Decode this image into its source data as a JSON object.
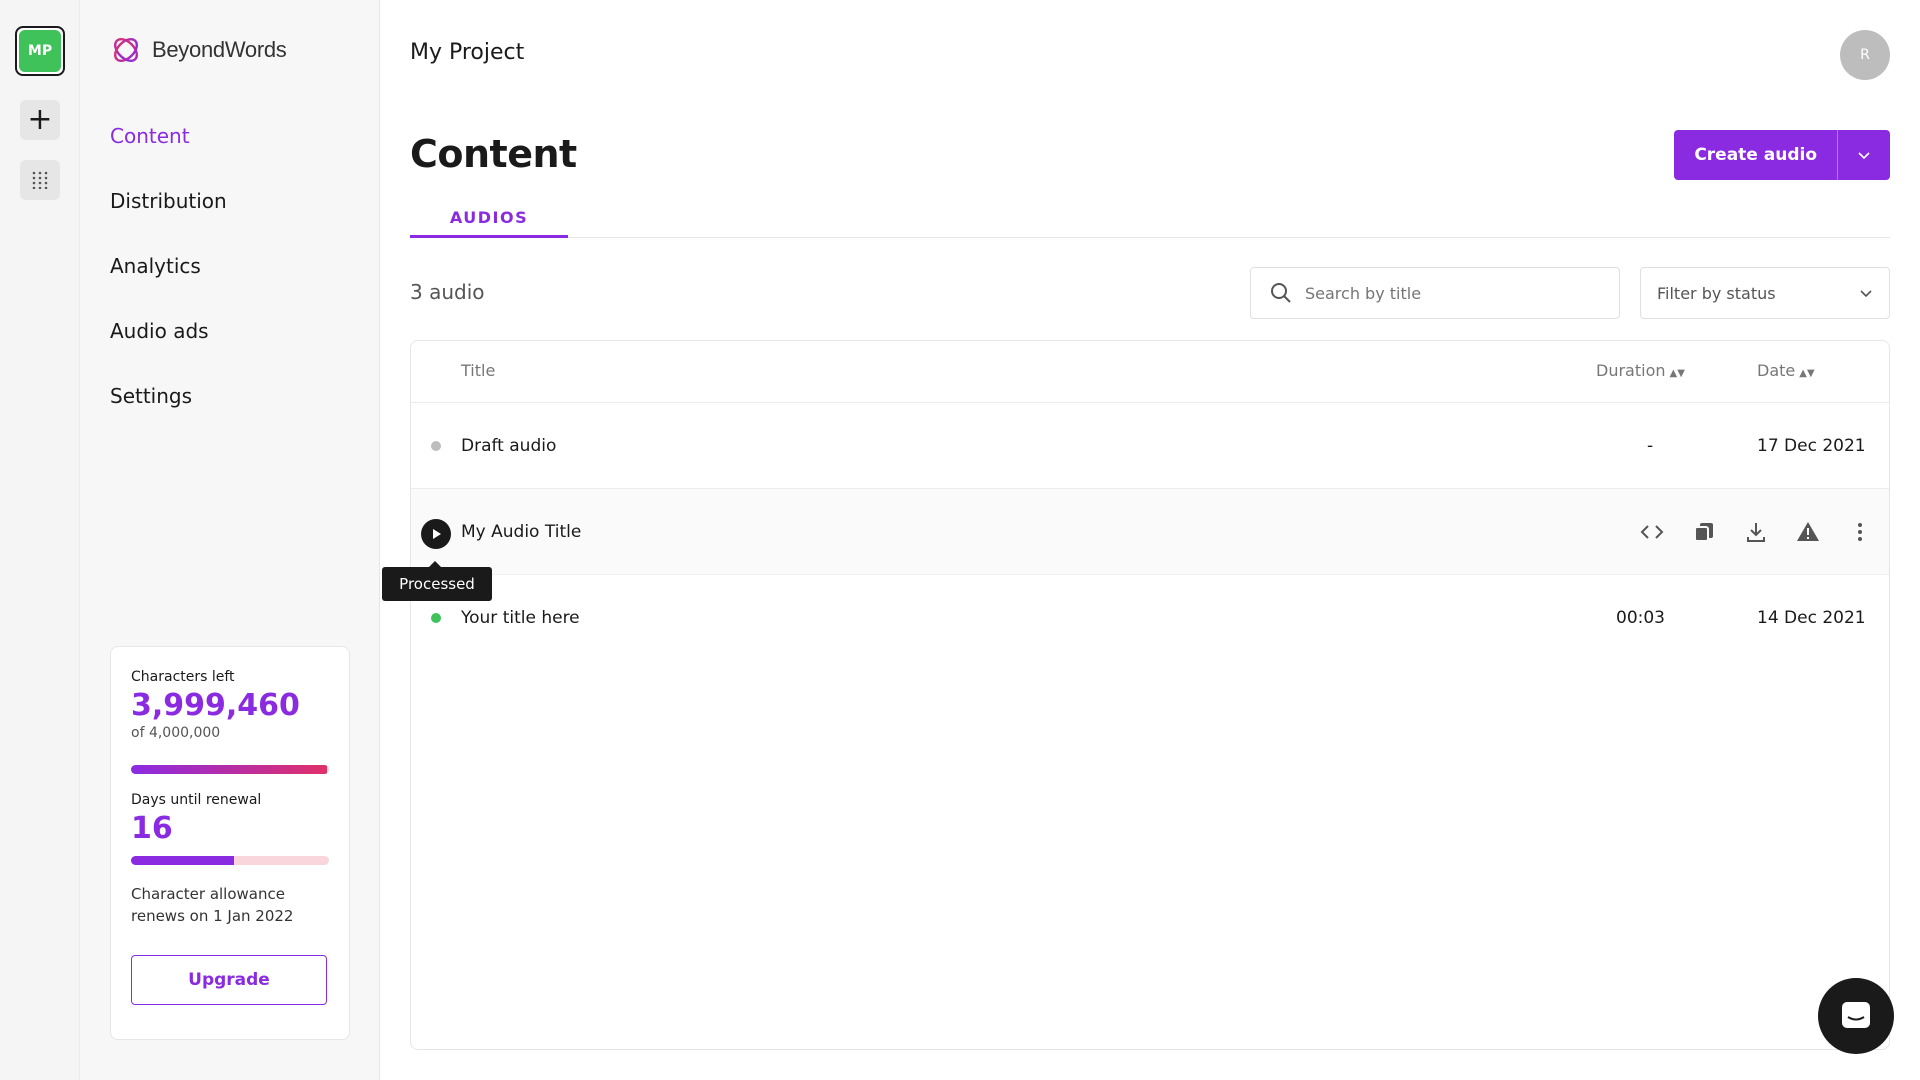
{
  "rail": {
    "workspace_initials": "MP"
  },
  "brand": {
    "name": "BeyondWords"
  },
  "nav": [
    {
      "label": "Content",
      "active": true
    },
    {
      "label": "Distribution",
      "active": false
    },
    {
      "label": "Analytics",
      "active": false
    },
    {
      "label": "Audio ads",
      "active": false
    },
    {
      "label": "Settings",
      "active": false
    }
  ],
  "usage": {
    "chars_label": "Characters left",
    "chars_value": "3,999,460",
    "chars_total": "of 4,000,000",
    "chars_fraction": 0.99,
    "days_label": "Days until renewal",
    "days_value": "16",
    "days_fraction": 0.52,
    "renew_note": "Character allowance renews on 1 Jan 2022",
    "upgrade_label": "Upgrade"
  },
  "header": {
    "project": "My Project",
    "avatar_initial": "R"
  },
  "page": {
    "title": "Content",
    "create_label": "Create audio"
  },
  "tabs": [
    {
      "label": "AUDIOS",
      "active": true
    }
  ],
  "toolbar": {
    "count": "3 audio",
    "search_placeholder": "Search by title",
    "filter_placeholder": "Filter by status"
  },
  "table": {
    "headers": {
      "title": "Title",
      "duration": "Duration",
      "date": "Date"
    },
    "rows": [
      {
        "title": "Draft audio",
        "duration": "-",
        "date": "17 Dec 2021",
        "status_color": "#bdbdbd"
      },
      {
        "title": "My Audio Title",
        "duration": "",
        "date": "",
        "status_color": "#1a1a1a"
      },
      {
        "title": "Your title here",
        "duration": "00:03",
        "date": "14 Dec 2021",
        "status_color": "#3ec259"
      }
    ],
    "tooltip": "Processed"
  },
  "colors": {
    "accent": "#8a2be2",
    "success": "#3ec259"
  }
}
